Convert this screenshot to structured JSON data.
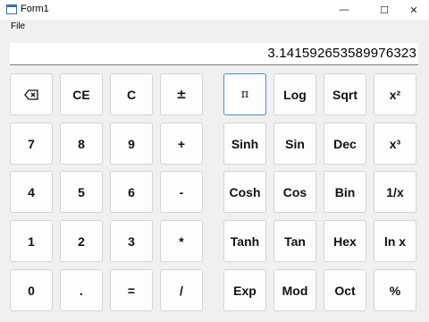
{
  "window": {
    "title": "Form1",
    "minimize_glyph": "—",
    "maximize_glyph": "☐",
    "close_glyph": "✕"
  },
  "menu": {
    "file_label": "File"
  },
  "display": {
    "value": "3.141592653589976323"
  },
  "keys": {
    "ce": "CE",
    "c": "C",
    "plus_minus": "±",
    "pi": "π",
    "log": "Log",
    "sqrt": "Sqrt",
    "square": "x²",
    "seven": "7",
    "eight": "8",
    "nine": "9",
    "plus": "+",
    "sinh": "Sinh",
    "sin": "Sin",
    "dec": "Dec",
    "cube": "x³",
    "four": "4",
    "five": "5",
    "six": "6",
    "minus": "-",
    "cosh": "Cosh",
    "cos": "Cos",
    "bin": "Bin",
    "reciprocal": "1/x",
    "one": "1",
    "two": "2",
    "three": "3",
    "multiply": "*",
    "tanh": "Tanh",
    "tan": "Tan",
    "hex": "Hex",
    "ln": "ln x",
    "zero": "0",
    "dot": ".",
    "equals": "=",
    "divide": "/",
    "exp": "Exp",
    "mod": "Mod",
    "oct": "Oct",
    "percent": "%"
  },
  "icons": {
    "backspace": "backspace-icon"
  },
  "colors": {
    "focus_border": "#4a8ec4",
    "button_bg": "#fdfdfd",
    "window_bg": "#f0f0f0"
  }
}
